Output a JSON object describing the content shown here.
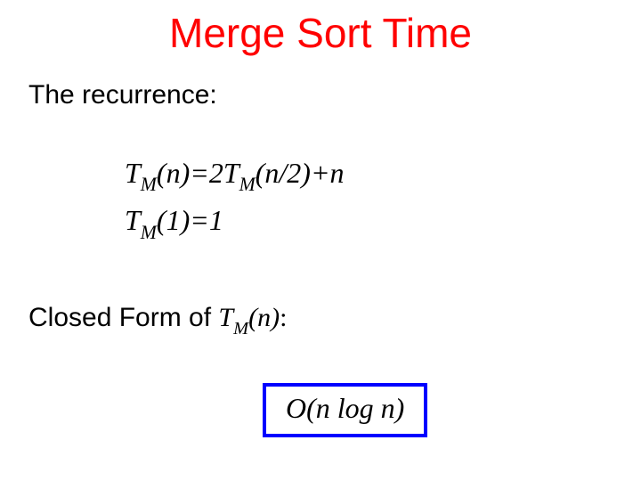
{
  "title": "Merge Sort Time",
  "subhead_recurrence": "The recurrence:",
  "eq": {
    "line1": {
      "T1": "T",
      "M1": "M",
      "open1": "(",
      "n1": "n",
      "close1": ")",
      "eq": "=",
      "two": "2",
      "T2": "T",
      "M2": "M",
      "open2": "(",
      "n2": "n/2",
      "close2": ")",
      "plus": "+",
      "n3": "n"
    },
    "line2": {
      "T": "T",
      "M": "M",
      "open": "(",
      "one": "1",
      "close": ")",
      "eq": "=",
      "rhs": "1"
    }
  },
  "closed_form_prefix": "Closed Form of ",
  "closed_form_expr": {
    "T": "T",
    "M": "M",
    "open": "(",
    "n": "n",
    "close": ")"
  },
  "closed_form_colon": ":",
  "answer": "O(n log n)"
}
